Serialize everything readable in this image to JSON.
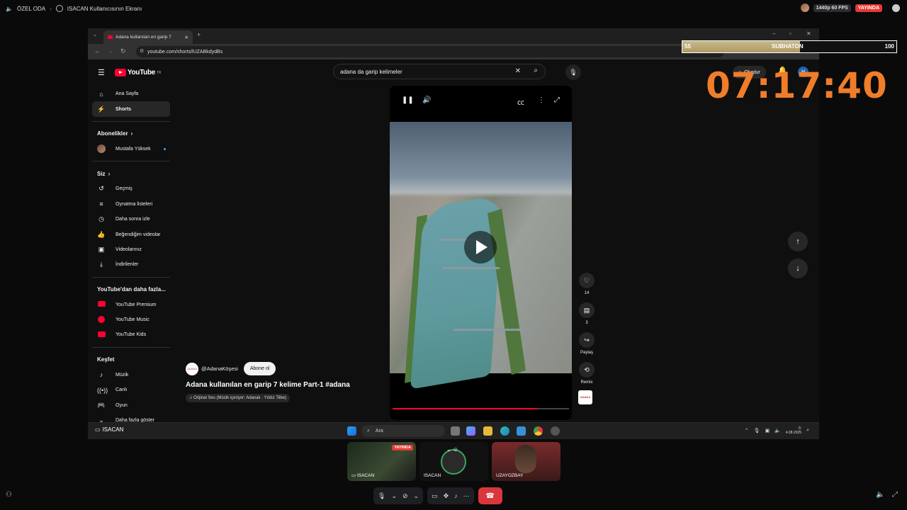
{
  "discord": {
    "channel": "ÖZEL ODA",
    "screen_title": "ISACAN Kullanıcısının Ekranı",
    "quality": "1440p 60 FPS",
    "live": "YAYINDA",
    "participants": [
      {
        "name": "ISACAN",
        "live": "YAYINDA"
      },
      {
        "name": "ISACAN"
      },
      {
        "name": "UZAYOZBAY"
      }
    ]
  },
  "browser": {
    "tab_title": "Adana kullanılan en garip 7",
    "url": "youtube.com/shorts/lUZABkdydBs"
  },
  "youtube": {
    "logo": "YouTube",
    "region": "TR",
    "search_value": "adana da garip kelimeler",
    "create_label": "Oluştur",
    "avatar_letter": "H",
    "sidebar": {
      "home": "Ana Sayfa",
      "shorts": "Shorts",
      "subscriptions_head": "Abonelikler",
      "subscription": "Mustafa Yüksek",
      "you_head": "Siz",
      "history": "Geçmiş",
      "playlists": "Oynatma listeleri",
      "watch_later": "Daha sonra izle",
      "liked": "Beğendiğim videolar",
      "your_videos": "Videolarınız",
      "downloads": "İndirilenler",
      "more_head": "YouTube'dan daha fazla...",
      "premium": "YouTube Premium",
      "music": "YouTube Music",
      "kids": "YouTube Kids",
      "explore_head": "Keşfet",
      "music_cat": "Müzik",
      "live": "Canlı",
      "gaming": "Oyun",
      "show_more": "Daha fazla göster"
    },
    "short": {
      "channel": "@AdanaKöşesi",
      "subscribe": "Abone ol",
      "title": "Adana kullanılan en garip 7 kelime Part-1 #adana",
      "sound": "Orijinal Ses (Müzik içeriyor: Adanalı · Yıldız Tilbe)",
      "likes": "14",
      "comments": "3",
      "share": "Paylaş",
      "remix": "Remix",
      "progress": 0.82
    }
  },
  "overlay": {
    "subhaton_left": "55",
    "subhaton_label": "SUBHATON",
    "subhaton_right": "100",
    "subhaton_fill": 0.55,
    "timer": "07:17:40"
  },
  "taskbar": {
    "user": "ISACAN",
    "search_placeholder": "Ara",
    "date": "4.08.2025"
  }
}
